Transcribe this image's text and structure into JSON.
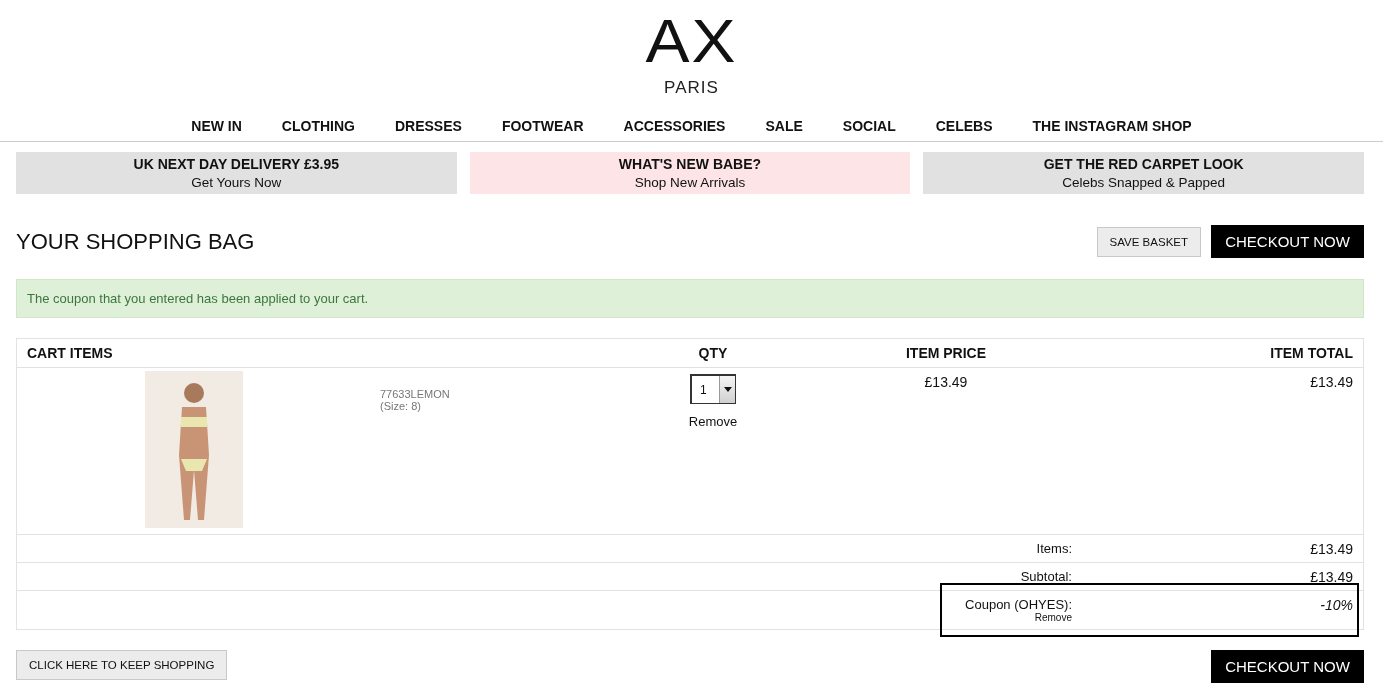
{
  "logo": {
    "mark": "AX",
    "city": "PARIS"
  },
  "nav": [
    "NEW IN",
    "CLOTHING",
    "DRESSES",
    "FOOTWEAR",
    "ACCESSORIES",
    "SALE",
    "SOCIAL",
    "CELEBS",
    "THE INSTAGRAM SHOP"
  ],
  "promos": [
    {
      "title": "UK NEXT DAY DELIVERY £3.95",
      "subtitle": "Get Yours Now",
      "color": "#e1e1e1"
    },
    {
      "title": "WHAT'S NEW BABE?",
      "subtitle": "Shop New Arrivals",
      "color": "#fde4e6"
    },
    {
      "title": "GET THE RED CARPET LOOK",
      "subtitle": "Celebs Snapped & Papped",
      "color": "#e1e1e1"
    }
  ],
  "page_title": "YOUR SHOPPING BAG",
  "save_button": "SAVE BASKET",
  "checkout_button": "CHECKOUT NOW",
  "alert": "The coupon that you entered has been applied to your cart.",
  "table": {
    "columns": [
      "CART ITEMS",
      "QTY",
      "ITEM PRICE",
      "ITEM TOTAL"
    ],
    "rows": [
      {
        "sku": "77633LEMON",
        "size": "(Size: 8)",
        "qty": "1",
        "remove": "Remove",
        "price": "£13.49",
        "total": "£13.49"
      }
    ]
  },
  "summary": [
    {
      "label": "Items:",
      "value": "£13.49",
      "highlighted": false
    },
    {
      "label": "Subtotal:",
      "value": "£13.49",
      "highlighted": false
    },
    {
      "label": "Coupon (OHYES):",
      "remove": "Remove",
      "value": "-10%",
      "highlighted": true
    }
  ],
  "keep_shopping_button": "CLICK HERE TO KEEP SHOPPING",
  "checkout_button_bottom": "CHECKOUT NOW"
}
